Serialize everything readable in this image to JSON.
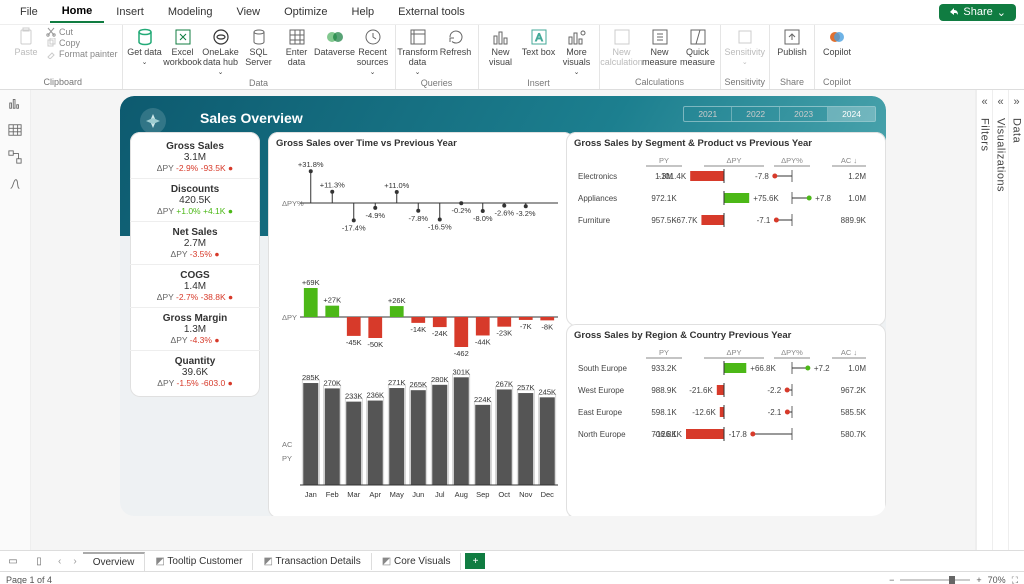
{
  "menu": {
    "items": [
      "File",
      "Home",
      "Insert",
      "Modeling",
      "View",
      "Optimize",
      "Help",
      "External tools"
    ],
    "active": 1,
    "share": "Share"
  },
  "ribbon": {
    "clipboard": {
      "paste": "Paste",
      "cut": "Cut",
      "copy": "Copy",
      "fmt": "Format painter",
      "label": "Clipboard"
    },
    "data": {
      "get": "Get data",
      "excel": "Excel workbook",
      "onelake": "OneLake data hub",
      "sql": "SQL Server",
      "enter": "Enter data",
      "dataverse": "Dataverse",
      "recent": "Recent sources",
      "label": "Data"
    },
    "queries": {
      "transform": "Transform data",
      "refresh": "Refresh",
      "label": "Queries"
    },
    "insert": {
      "visual": "New visual",
      "text": "Text box",
      "more": "More visuals",
      "label": "Insert"
    },
    "calc": {
      "newcalc": "New calculation",
      "measure": "New measure",
      "quick": "Quick measure",
      "label": "Calculations"
    },
    "sens": {
      "btn": "Sensitivity",
      "label": "Sensitivity"
    },
    "share": {
      "publish": "Publish",
      "label": "Share"
    },
    "copilot": {
      "btn": "Copilot",
      "label": "Copilot"
    }
  },
  "panes": {
    "filters": "Filters",
    "viz": "Visualizations",
    "data": "Data"
  },
  "report": {
    "title": "Sales Overview",
    "years": [
      "2021",
      "2022",
      "2023",
      "2024"
    ],
    "active_year": 3,
    "kpis": [
      {
        "t": "Gross Sales",
        "v": "3.1M",
        "s_label": "ΔPY",
        "s_pct": "-2.9%",
        "s_abs": "-93.5K",
        "color": "#d73a2a"
      },
      {
        "t": "Discounts",
        "v": "420.5K",
        "s_label": "ΔPY",
        "s_pct": "+1.0%",
        "s_abs": "+4.1K",
        "color": "#4cb817"
      },
      {
        "t": "Net Sales",
        "v": "2.7M",
        "s_label": "ΔPY",
        "s_pct": "-3.5%",
        "s_abs": "",
        "color": "#d73a2a"
      },
      {
        "t": "COGS",
        "v": "1.4M",
        "s_label": "ΔPY",
        "s_pct": "-2.7%",
        "s_abs": "-38.8K",
        "color": "#d73a2a"
      },
      {
        "t": "Gross Margin",
        "v": "1.3M",
        "s_label": "ΔPY",
        "s_pct": "-4.3%",
        "s_abs": "",
        "color": "#d73a2a"
      },
      {
        "t": "Quantity",
        "v": "39.6K",
        "s_label": "ΔPY",
        "s_pct": "-1.5%",
        "s_abs": "-603.0",
        "color": "#d73a2a"
      }
    ],
    "time_chart_title": "Gross Sales over Time vs Previous Year",
    "segment_chart_title": "Gross Sales by Segment & Product vs Previous Year",
    "region_chart_title": "Gross Sales by Region & Country Previous Year"
  },
  "chart_data": {
    "time_pct": {
      "type": "lollipop",
      "ylabel": "ΔPY%",
      "categories": [
        "Jan",
        "Feb",
        "Mar",
        "Apr",
        "May",
        "Jun",
        "Jul",
        "Aug",
        "Sep",
        "Oct",
        "Nov",
        "Dec"
      ],
      "values": [
        31.8,
        11.3,
        -17.4,
        -4.9,
        11.0,
        -7.8,
        -16.5,
        -0.2,
        -8.0,
        -2.6,
        -3.2,
        null
      ],
      "labels": [
        "+31.8%",
        "+11.3%",
        "-17.4%",
        "-4.9%",
        "+11.0%",
        "-7.8%",
        "-16.5%",
        "-0.2%",
        "-8.0%",
        "-2.6%",
        "-3.2%",
        ""
      ]
    },
    "time_abs": {
      "type": "bar",
      "ylabel": "ΔPY",
      "categories": [
        "Jan",
        "Feb",
        "Mar",
        "Apr",
        "May",
        "Jun",
        "Jul",
        "Aug",
        "Sep",
        "Oct",
        "Nov",
        "Dec"
      ],
      "values": [
        69,
        27,
        -45,
        -50,
        26,
        -14,
        -24,
        -462,
        -44,
        -23,
        -7,
        -8
      ],
      "labels": [
        "+69K",
        "+27K",
        "-45K",
        "-50K",
        "+26K",
        "-14K",
        "-24K",
        "-462",
        "-44K",
        "-23K",
        "-7K",
        "-8K"
      ]
    },
    "time_ac": {
      "type": "bar",
      "ylabel": "AC / PY",
      "categories": [
        "Jan",
        "Feb",
        "Mar",
        "Apr",
        "May",
        "Jun",
        "Jul",
        "Aug",
        "Sep",
        "Oct",
        "Nov",
        "Dec"
      ],
      "ac": [
        285,
        270,
        233,
        236,
        271,
        265,
        280,
        301,
        224,
        267,
        257,
        245
      ],
      "labels": [
        "285K",
        "270K",
        "233K",
        "236K",
        "271K",
        "265K",
        "280K",
        "301K",
        "224K",
        "267K",
        "257K",
        "245K"
      ]
    },
    "segment": {
      "type": "table",
      "columns": [
        "",
        "PY",
        "ΔPY",
        "ΔPY%",
        "AC ↓"
      ],
      "rows": [
        {
          "name": "Electronics",
          "py": "1.3M",
          "dpy": "-101.4K",
          "dpyp": "-7.8",
          "ac": "1.2M",
          "dpy_sign": -1
        },
        {
          "name": "Appliances",
          "py": "972.1K",
          "dpy": "+75.6K",
          "dpyp": "+7.8",
          "ac": "1.0M",
          "dpy_sign": 1
        },
        {
          "name": "Furniture",
          "py": "957.5K",
          "dpy": "-67.7K",
          "dpyp": "-7.1",
          "ac": "889.9K",
          "dpy_sign": -1
        }
      ]
    },
    "region": {
      "type": "table",
      "columns": [
        "",
        "PY",
        "ΔPY",
        "ΔPY%",
        "AC ↓"
      ],
      "rows": [
        {
          "name": "South Europe",
          "py": "933.2K",
          "dpy": "+66.8K",
          "dpyp": "+7.2",
          "ac": "1.0M",
          "dpy_sign": 1
        },
        {
          "name": "West Europe",
          "py": "988.9K",
          "dpy": "-21.6K",
          "dpyp": "-2.2",
          "ac": "967.2K",
          "dpy_sign": -1
        },
        {
          "name": "East Europe",
          "py": "598.1K",
          "dpy": "-12.6K",
          "dpyp": "-2.1",
          "ac": "585.5K",
          "dpy_sign": -1
        },
        {
          "name": "North Europe",
          "py": "706.8K",
          "dpy": "-126.1K",
          "dpyp": "-17.8",
          "ac": "580.7K",
          "dpy_sign": -1
        }
      ]
    }
  },
  "tabs": {
    "items": [
      "Overview",
      "Tooltip Customer",
      "Transaction Details",
      "Core Visuals"
    ],
    "active": 0
  },
  "status": {
    "page": "Page 1 of 4",
    "zoom": "70%"
  }
}
